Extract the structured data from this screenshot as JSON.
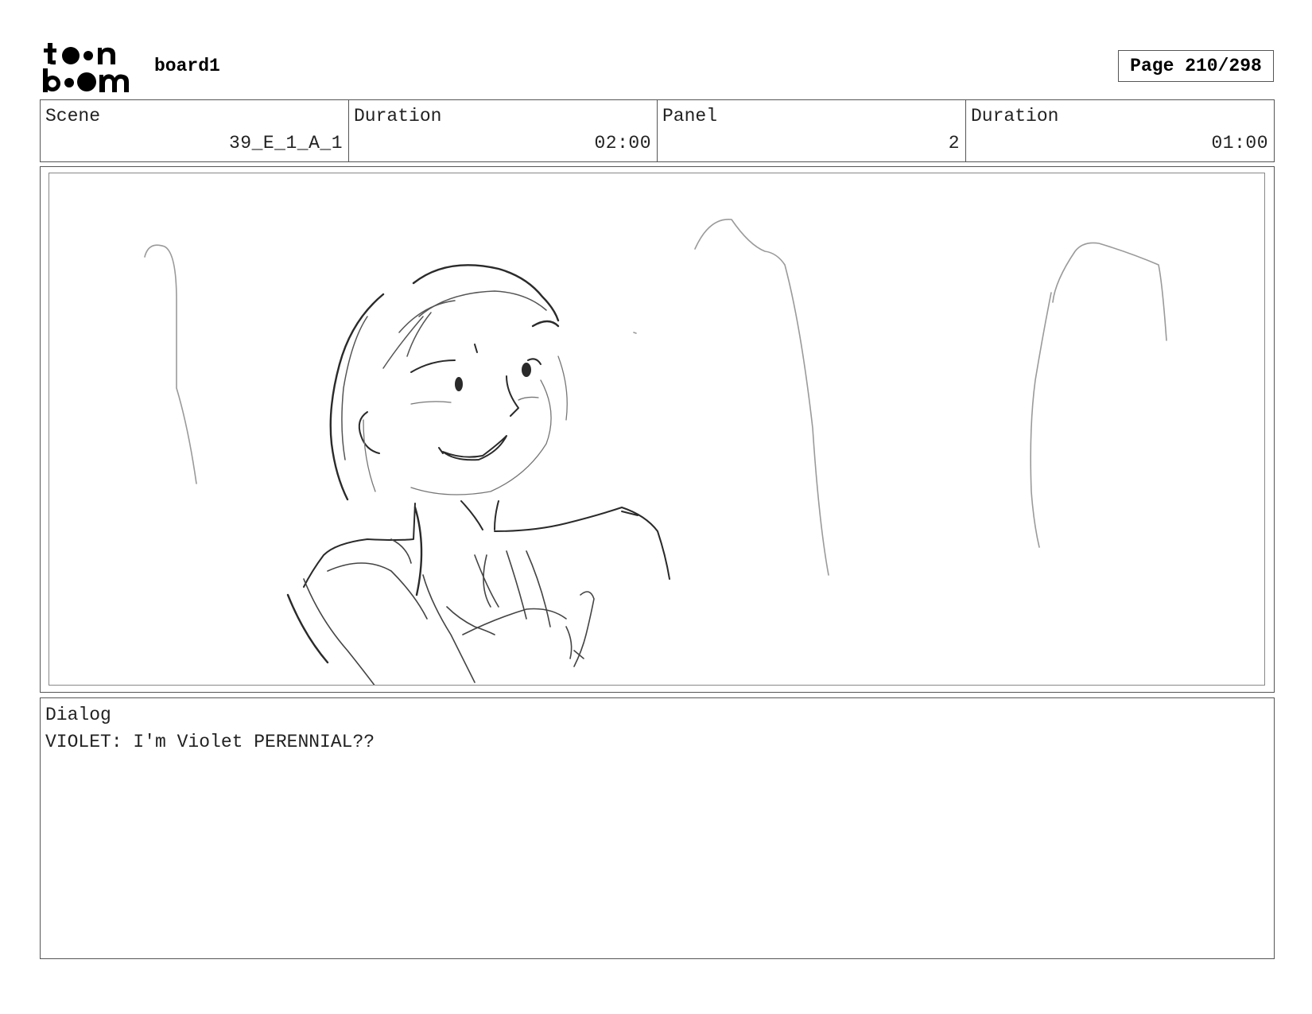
{
  "header": {
    "logo_name": "toon boom",
    "board_name": "board1",
    "page_label": "Page 210/298"
  },
  "info": {
    "scene_label": "Scene",
    "scene_value": "39_E_1_A_1",
    "scene_duration_label": "Duration",
    "scene_duration_value": "02:00",
    "panel_label": "Panel",
    "panel_value": "2",
    "panel_duration_label": "Duration",
    "panel_duration_value": "01:00"
  },
  "panel": {
    "image_description_icon": "storyboard-sketch"
  },
  "dialog": {
    "label": "Dialog",
    "text": "VIOLET: I'm Violet PERENNIAL??"
  }
}
